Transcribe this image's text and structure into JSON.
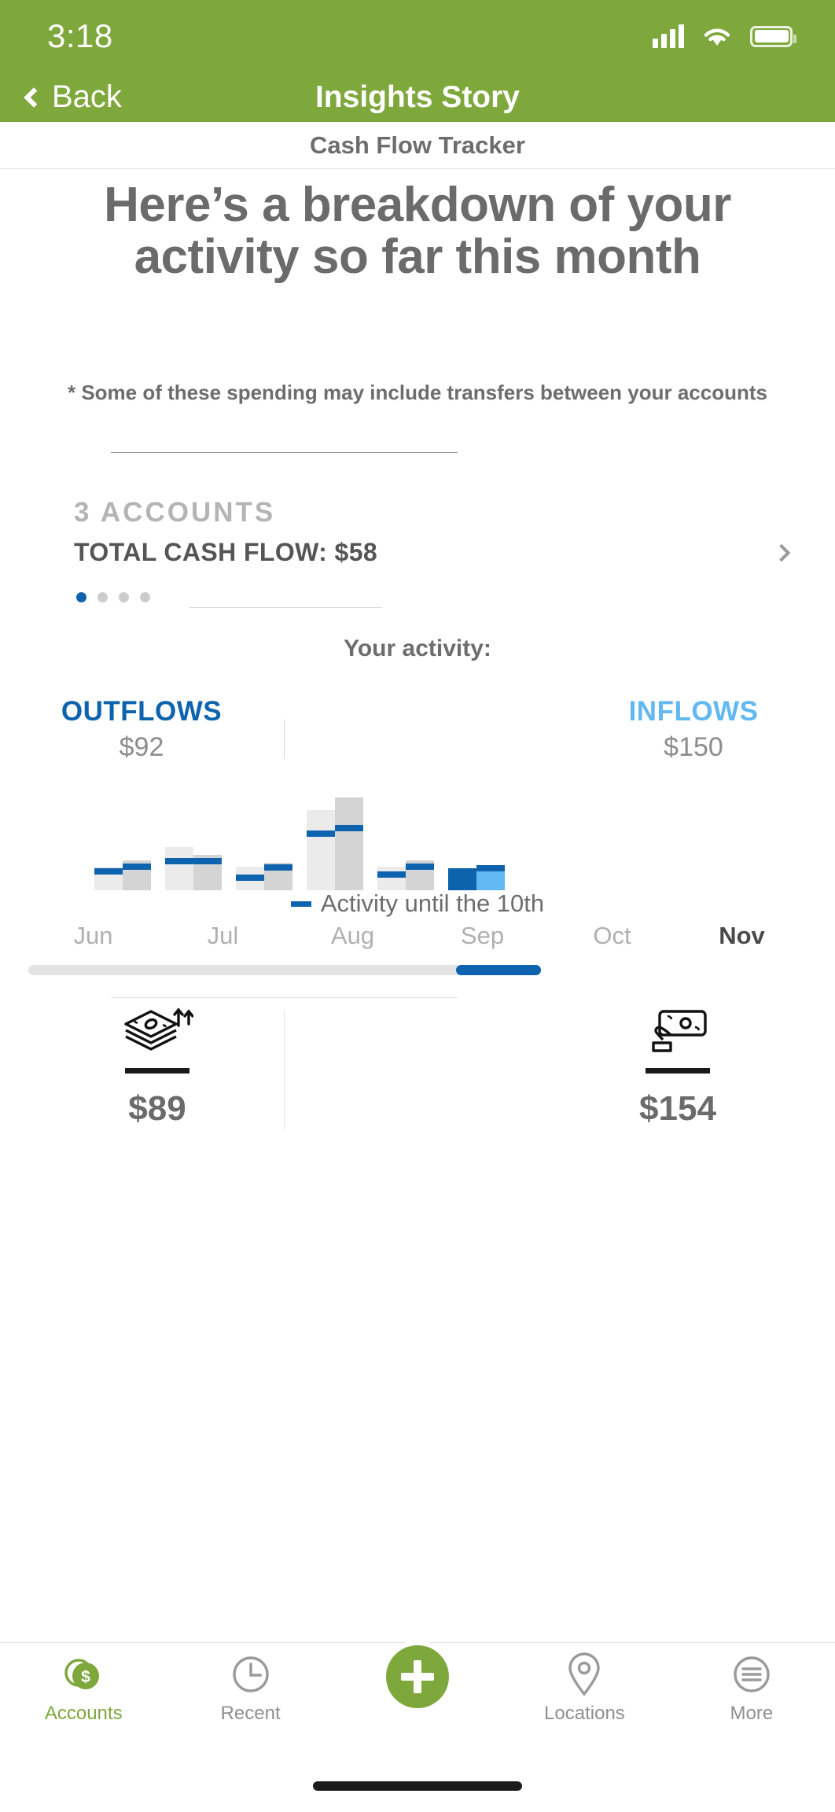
{
  "status_bar": {
    "time": "3:18",
    "signal_icon": "cellular-signal-icon",
    "wifi_icon": "wifi-icon",
    "battery_icon": "battery-icon"
  },
  "nav": {
    "back_label": "Back",
    "title": "Insights Story",
    "back_icon": "chevron-left-icon",
    "bg_color": "#7EA73C"
  },
  "page": {
    "subtitle": "Cash Flow Tracker",
    "headline": "Here’s a breakdown of your activity so far this month",
    "disclaimer": "* Some of these spending may include transfers between your accounts"
  },
  "accounts_card": {
    "count_label": "3 ACCOUNTS",
    "total_label": "TOTAL CASH FLOW: $58",
    "chevron_icon": "chevron-right-icon",
    "pager": {
      "total": 4,
      "active_index": 0,
      "active_color": "#0d63ad"
    }
  },
  "activity": {
    "title": "Your activity:",
    "outflows": {
      "label": "OUTFLOWS",
      "amount": "$92",
      "color": "#0d63ad"
    },
    "inflows": {
      "label": "INFLOWS",
      "amount": "$150",
      "color": "#62b8f0"
    },
    "legend": {
      "text": "Activity until the 10th",
      "swatch_color": "#0d63ad"
    },
    "scrollbar": {
      "track_color": "#e3e3e3",
      "thumb_color": "#0d63ad",
      "thumb_position": "right"
    }
  },
  "summary": {
    "outflow": {
      "icon": "cash-stack-outflow-icon",
      "amount": "$89"
    },
    "inflow": {
      "icon": "hand-holding-cash-icon",
      "amount": "$154"
    }
  },
  "tabbar": {
    "items": [
      {
        "label": "Accounts",
        "icon": "dollar-coins-icon",
        "active": true
      },
      {
        "label": "Recent",
        "icon": "clock-icon",
        "active": false
      },
      {
        "label": "Locations",
        "icon": "map-pin-icon",
        "active": false
      },
      {
        "label": "More",
        "icon": "hamburger-menu-icon",
        "active": false
      }
    ],
    "fab": {
      "icon": "plus-icon",
      "color": "#7EA73C"
    }
  },
  "chart_data": {
    "type": "bar",
    "title": "Your activity:",
    "categories": [
      "Jun",
      "Jul",
      "Aug",
      "Sep",
      "Oct",
      "Nov"
    ],
    "series": [
      {
        "name": "OUTFLOWS",
        "color": "#ebebeb",
        "highlight_color": "#0d63ad",
        "values": [
          30,
          55,
          30,
          102,
          30,
          20
        ]
      },
      {
        "name": "INFLOWS",
        "color": "#d4d4d4",
        "highlight_color": "#62b8f0",
        "values": [
          38,
          45,
          35,
          118,
          38,
          24
        ]
      }
    ],
    "markers": {
      "name": "Activity until the 10th",
      "color": "#0d63ad",
      "outflow_values": [
        20,
        33,
        12,
        68,
        16,
        20
      ],
      "inflow_values": [
        26,
        33,
        25,
        75,
        26,
        24
      ]
    },
    "highlight_category": "Nov",
    "ylim": [
      0,
      132
    ],
    "grid": false,
    "legend": "Activity until the 10th",
    "xlabel": "",
    "ylabel": ""
  }
}
